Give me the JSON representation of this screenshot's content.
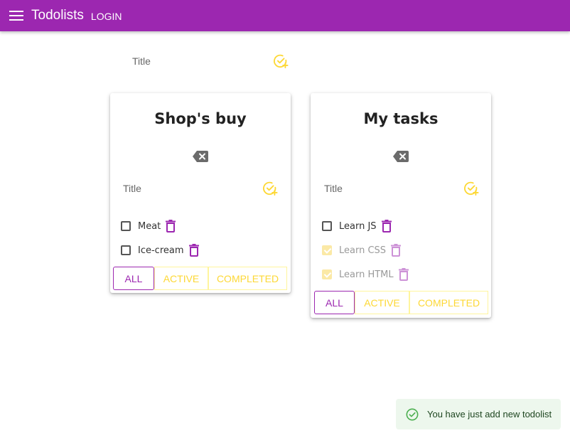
{
  "appbar": {
    "title": "Todolists",
    "login_label": "LOGIN"
  },
  "add_todolist": {
    "placeholder": "Title"
  },
  "todolists": [
    {
      "title": "Shop's buy",
      "add_task_placeholder": "Title",
      "tasks": [
        {
          "title": "Meat",
          "done": false
        },
        {
          "title": "Ice-cream",
          "done": false
        }
      ],
      "filters": {
        "all": "ALL",
        "active": "ACTIVE",
        "completed": "COMPLETED",
        "selected": "all"
      }
    },
    {
      "title": "My tasks",
      "add_task_placeholder": "Title",
      "tasks": [
        {
          "title": "Learn JS",
          "done": false
        },
        {
          "title": "Learn CSS",
          "done": true
        },
        {
          "title": "Learn HTML",
          "done": true
        }
      ],
      "filters": {
        "all": "ALL",
        "active": "ACTIVE",
        "completed": "COMPLETED",
        "selected": "all"
      }
    }
  ],
  "snackbar": {
    "message": "You have just add new todolist",
    "severity": "success"
  },
  "colors": {
    "primary": "#9c27b0",
    "secondary": "#fdd835",
    "success_bg": "#edf7ed",
    "success_icon": "#4caf50"
  },
  "icons": {
    "menu": "menu-icon",
    "add": "add-task-icon",
    "delete_list": "backspace-icon",
    "delete_task": "trash-icon",
    "success": "check-circle-icon"
  }
}
